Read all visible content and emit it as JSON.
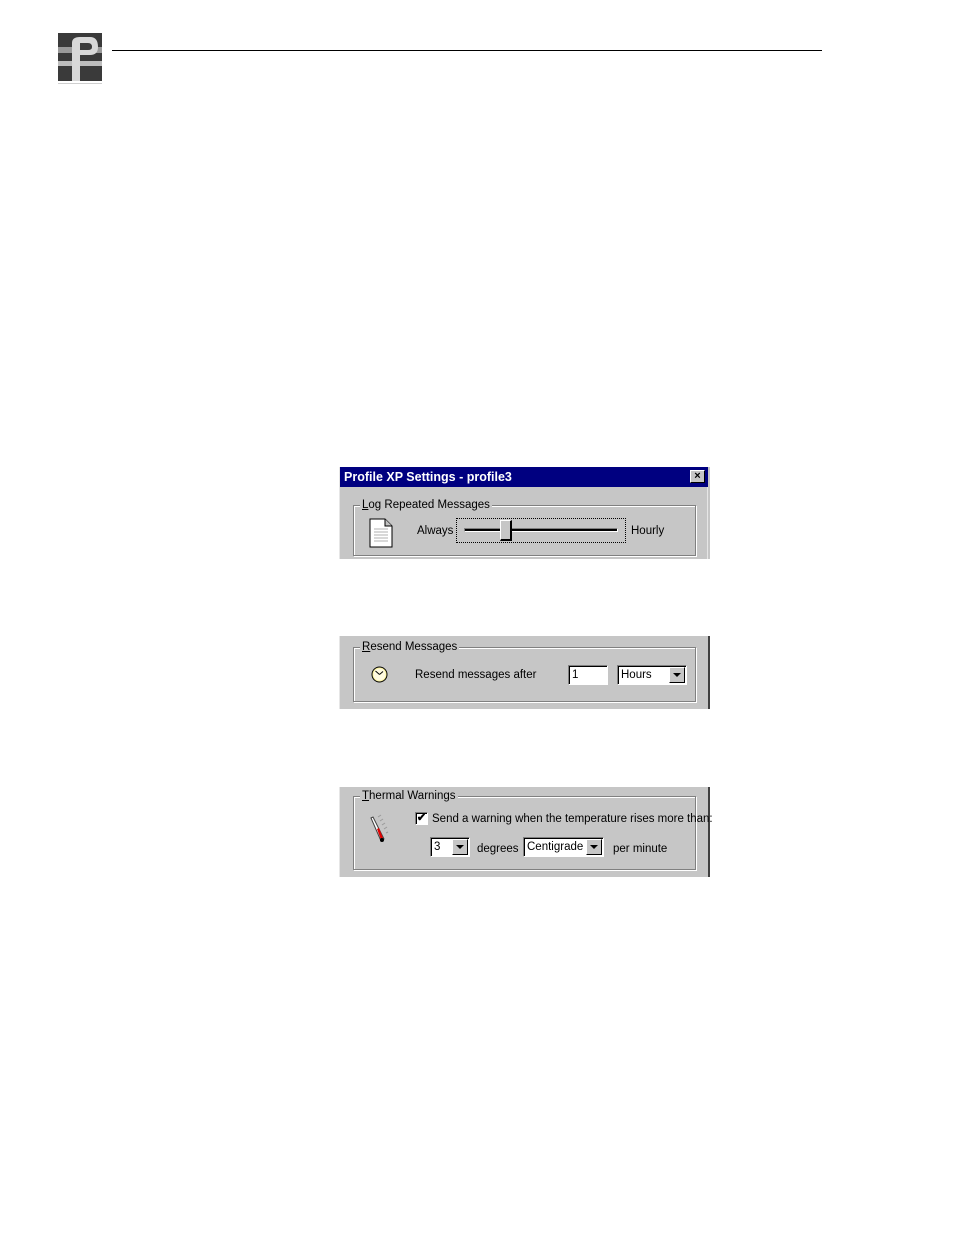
{
  "header": {
    "logo_icon": "profile-p-logo"
  },
  "dialog": {
    "title": "Profile XP Settings - profile3",
    "close_icon": "close-x-icon",
    "close_glyph": "×"
  },
  "log_repeated": {
    "group_label_first": "L",
    "group_label_rest": "og Repeated Messages",
    "icon": "document-icon",
    "min_label": "Always",
    "max_label": "Hourly",
    "slider_position_fraction": 0.27
  },
  "resend": {
    "group_label_first": "R",
    "group_label_rest": "esend Messages",
    "icon": "clock-icon",
    "label": "Resend messages after",
    "value": "1",
    "unit_selected": "Hours"
  },
  "thermal": {
    "group_label_first": "T",
    "group_label_rest": "hermal Warnings",
    "icon": "thermometer-icon",
    "checkbox_checked": true,
    "checkbox_glyph": "✔",
    "checkbox_label": "Send a warning when the temperature rises more than:",
    "degrees_selected": "3",
    "degrees_label": "degrees",
    "scale_selected": "Centigrade",
    "per_minute_label": "per minute"
  }
}
